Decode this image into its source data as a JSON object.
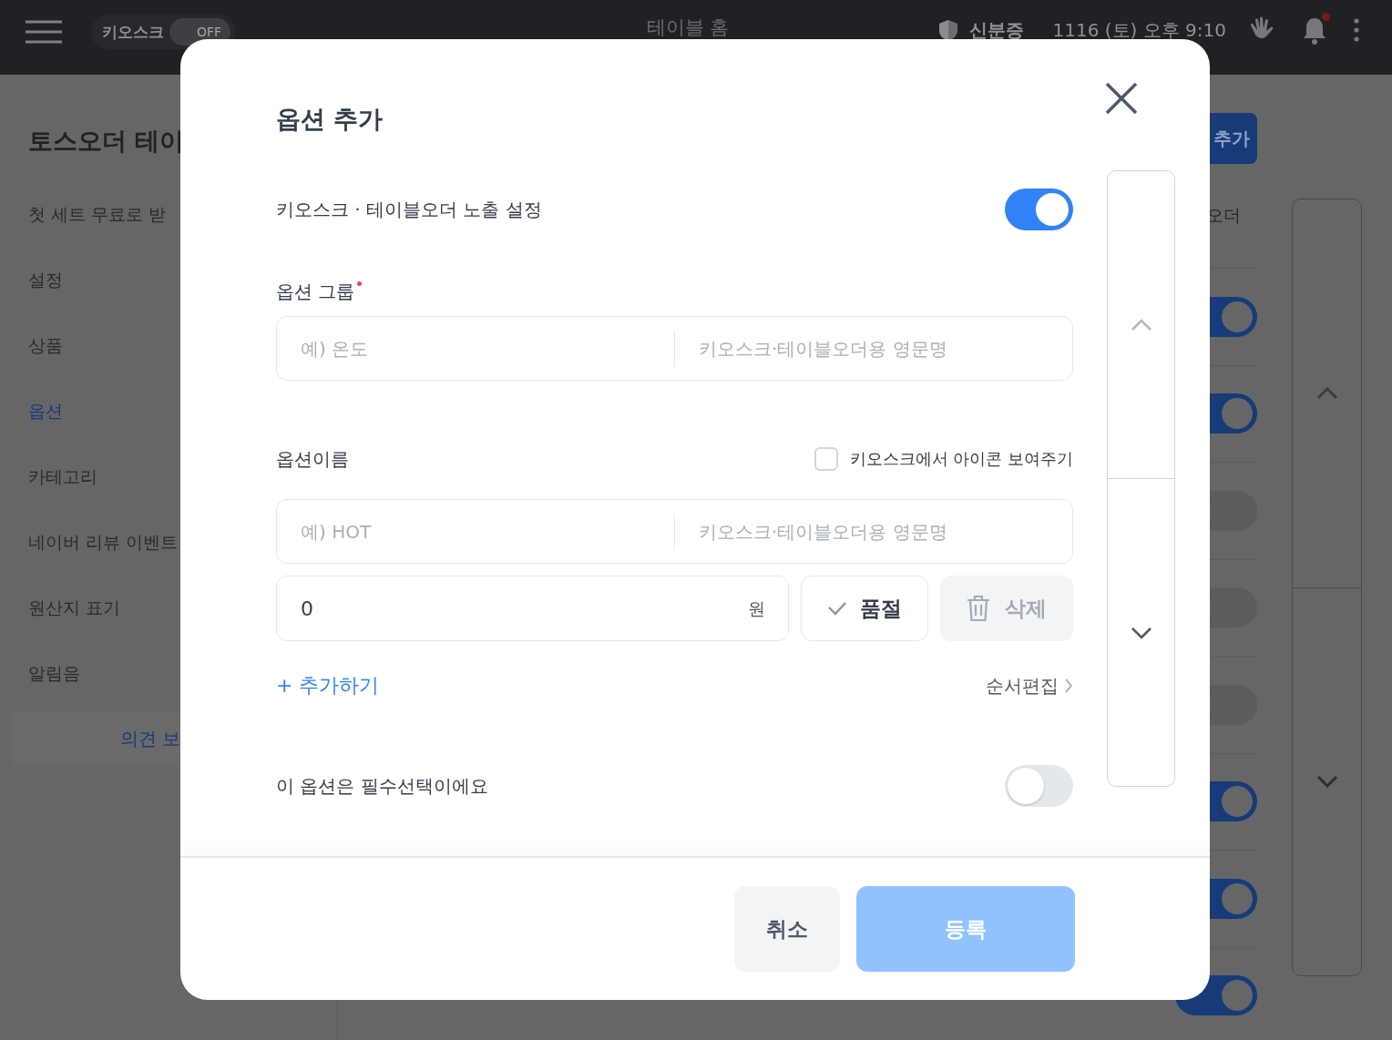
{
  "top_bar": {
    "kiosk_label": "키오스크",
    "kiosk_toggle": {
      "label": "OFF",
      "on": false
    },
    "title": "테이블 홈",
    "id_check": "신분증",
    "datetime": "1116 (토) 오후 9:10",
    "notifications": {
      "unread": true
    }
  },
  "sidebar": {
    "title": "토스오더 테이",
    "items": [
      {
        "label": "첫 세트 무료로 받",
        "selected": false
      },
      {
        "label": "설정",
        "selected": false
      },
      {
        "label": "상품",
        "selected": false
      },
      {
        "label": "옵션",
        "selected": true
      },
      {
        "label": "카테고리",
        "selected": false
      },
      {
        "label": "네이버 리뷰 이벤트",
        "selected": false
      },
      {
        "label": "원산지 표기",
        "selected": false
      },
      {
        "label": "알림음",
        "selected": false
      }
    ],
    "feedback": "의견 보"
  },
  "content": {
    "add_button": "추가",
    "column_header": "오더",
    "rows": [
      {
        "on": true
      },
      {
        "on": true
      },
      {
        "on": false
      },
      {
        "on": false
      },
      {
        "on": false
      },
      {
        "on": true
      },
      {
        "on": true
      },
      {
        "on": true
      }
    ]
  },
  "dialog": {
    "title": "옵션 추가",
    "visibility": {
      "label": "키오스크 · 테이블오더 노출 설정",
      "on": true
    },
    "group": {
      "label": "옵션 그룹",
      "required": true,
      "name_placeholder": "예) 온도",
      "english_placeholder": "키오스크·테이블오더용 영문명"
    },
    "option_name": {
      "label": "옵션이름",
      "show_icon": {
        "label": "키오스크에서 아이콘 보여주기",
        "checked": false
      }
    },
    "options": [
      {
        "name_placeholder": "예) HOT",
        "english_placeholder": "키오스크·테이블오더용 영문명",
        "price": "0",
        "unit": "원",
        "sold_out": {
          "label": "품절",
          "checked": false
        },
        "delete": {
          "label": "삭제",
          "disabled": true
        }
      }
    ],
    "add_link": "+ 추가하기",
    "reorder_link": "순서편집",
    "required_toggle": {
      "label": "이 옵션은 필수선택이에요",
      "on": false
    },
    "cancel": "취소",
    "submit": {
      "label": "등록",
      "disabled": true
    }
  }
}
